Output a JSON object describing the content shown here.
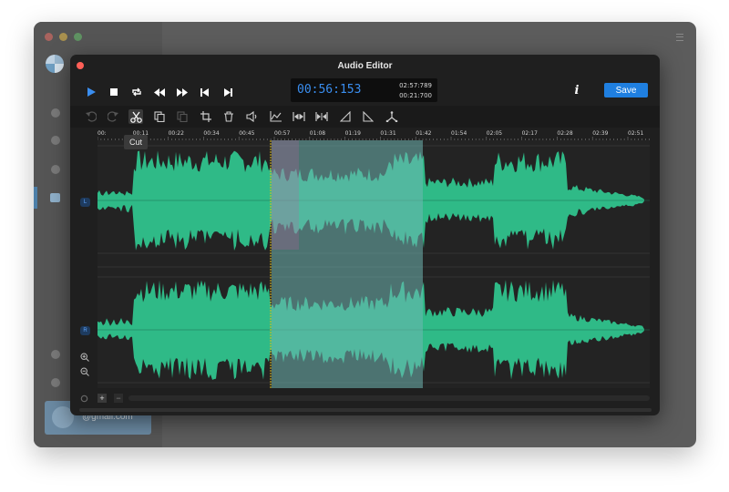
{
  "background_app": {
    "account_email": "@gmail.com"
  },
  "editor": {
    "title": "Audio Editor",
    "time": {
      "current": "00:56:153",
      "total": "02:57:789",
      "selection": "00:21:700"
    },
    "save_label": "Save",
    "info_label": "i",
    "tooltip": "Cut",
    "add_label": "+",
    "remove_label": "−",
    "channel_left": "L",
    "channel_right": "R",
    "ruler_ticks": [
      "00:",
      "00:11",
      "00:22",
      "00:34",
      "00:45",
      "00:57",
      "01:08",
      "01:19",
      "01:31",
      "01:42",
      "01:54",
      "02:05",
      "02:17",
      "02:28",
      "02:39",
      "02:51"
    ],
    "colors": {
      "waveform": "#2fba87",
      "selection": "#6fb6b2",
      "accent": "#1f7fe0",
      "time_text": "#3a8ef0",
      "playhead": "#e0c020"
    },
    "transport_icons": [
      "play-icon",
      "stop-icon",
      "loop-icon",
      "rewind-icon",
      "fast-forward-icon",
      "skip-back-icon",
      "skip-forward-icon"
    ],
    "tool_icons": [
      "undo-icon",
      "redo-icon",
      "cut-icon",
      "copy-icon",
      "paste-icon",
      "crop-icon",
      "delete-icon",
      "volume-icon",
      "effects-icon",
      "fade-in-out-icon",
      "normalize-icon",
      "fade-in-icon",
      "fade-out-icon",
      "split-icon"
    ]
  }
}
